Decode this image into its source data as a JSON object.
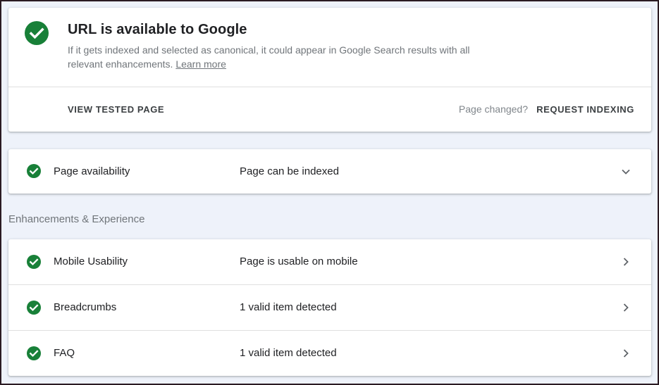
{
  "colors": {
    "success": "#188038",
    "text": "#202124",
    "muted": "#70757a",
    "background": "#eef2fa"
  },
  "summary": {
    "icon": "check-circle-icon",
    "title": "URL is available to Google",
    "description": "If it gets indexed and selected as canonical, it could appear in Google Search results with all relevant enhancements.",
    "learn_more": "Learn more"
  },
  "actions": {
    "view_tested_page": "VIEW TESTED PAGE",
    "page_changed": "Page changed?",
    "request_indexing": "REQUEST INDEXING"
  },
  "availability": {
    "label": "Page availability",
    "status": "Page can be indexed",
    "icon": "chevron-down-icon"
  },
  "enhancements": {
    "title": "Enhancements & Experience",
    "items": [
      {
        "label": "Mobile Usability",
        "status": "Page is usable on mobile",
        "icon": "chevron-right-icon"
      },
      {
        "label": "Breadcrumbs",
        "status": "1 valid item detected",
        "icon": "chevron-right-icon"
      },
      {
        "label": "FAQ",
        "status": "1 valid item detected",
        "icon": "chevron-right-icon"
      }
    ]
  }
}
